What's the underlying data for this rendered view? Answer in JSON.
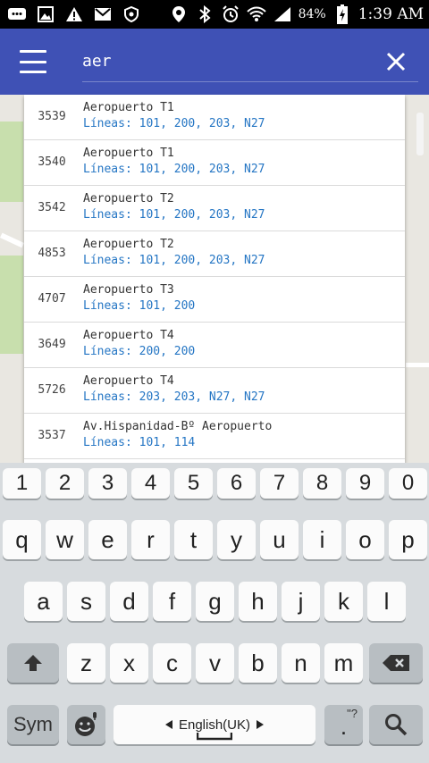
{
  "status_bar": {
    "battery": "84%",
    "time": "1:39 AM"
  },
  "search": {
    "query": "aer"
  },
  "results": [
    {
      "id": "3539",
      "name": "Aeropuerto T1",
      "lines": "Líneas: 101, 200, 203, N27"
    },
    {
      "id": "3540",
      "name": "Aeropuerto T1",
      "lines": "Líneas: 101, 200, 203, N27"
    },
    {
      "id": "3542",
      "name": "Aeropuerto T2",
      "lines": "Líneas: 101, 200, 203, N27"
    },
    {
      "id": "4853",
      "name": "Aeropuerto T2",
      "lines": "Líneas: 101, 200, 203, N27"
    },
    {
      "id": "4707",
      "name": "Aeropuerto T3",
      "lines": "Líneas: 101, 200"
    },
    {
      "id": "3649",
      "name": "Aeropuerto T4",
      "lines": "Líneas: 200, 200"
    },
    {
      "id": "5726",
      "name": "Aeropuerto T4",
      "lines": "Líneas: 203, 203, N27, N27"
    },
    {
      "id": "3537",
      "name": "Av.Hispanidad-Bº Aeropuerto",
      "lines": "Líneas: 101, 114"
    }
  ],
  "keyboard": {
    "numbers": [
      "1",
      "2",
      "3",
      "4",
      "5",
      "6",
      "7",
      "8",
      "9",
      "0"
    ],
    "row1": [
      "q",
      "w",
      "e",
      "r",
      "t",
      "y",
      "u",
      "i",
      "o",
      "p"
    ],
    "row2": [
      "a",
      "s",
      "d",
      "f",
      "g",
      "h",
      "j",
      "k",
      "l"
    ],
    "row3": [
      "z",
      "x",
      "c",
      "v",
      "b",
      "n",
      "m"
    ],
    "sym_label": "Sym",
    "space_label": "English(UK)",
    "period_label": ".",
    "period_hint": "\"?",
    "icons": [
      "shift-icon",
      "backspace-icon",
      "emoji-icon",
      "mic-icon",
      "search-icon",
      "arrow-left-icon",
      "arrow-right-icon"
    ]
  }
}
